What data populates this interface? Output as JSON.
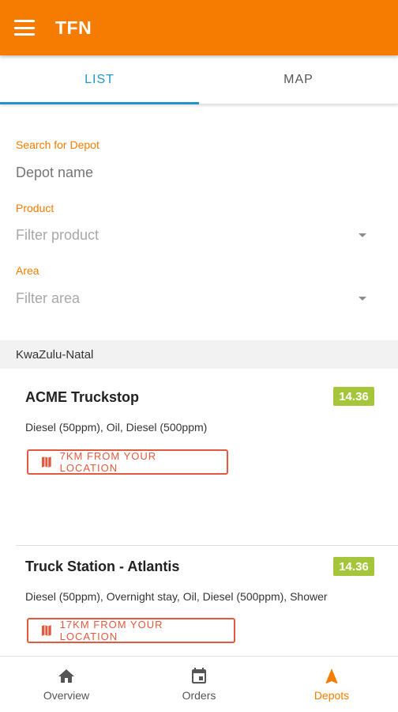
{
  "app": {
    "title": "TFN"
  },
  "tabs": [
    {
      "label": "LIST",
      "active": true
    },
    {
      "label": "MAP",
      "active": false
    }
  ],
  "filters": {
    "search": {
      "label": "Search for Depot",
      "placeholder": "Depot name",
      "value": ""
    },
    "product": {
      "label": "Product",
      "value": "Filter product"
    },
    "area": {
      "label": "Area",
      "value": "Filter area"
    }
  },
  "region": "KwaZulu-Natal",
  "depots": [
    {
      "name": "ACME Truckstop",
      "price": "14.36",
      "products": "Diesel (50ppm), Oil, Diesel (500ppm)",
      "distance": "7KM FROM YOUR LOCATION"
    },
    {
      "name": "Truck Station - Atlantis",
      "price": "14.36",
      "products": "Diesel (50ppm), Overnight stay, Oil, Diesel (500ppm), Shower",
      "distance": "17KM FROM YOUR LOCATION"
    }
  ],
  "bottom_nav": [
    {
      "label": "Overview",
      "icon": "home-icon",
      "active": false
    },
    {
      "label": "Orders",
      "icon": "calendar-icon",
      "active": false
    },
    {
      "label": "Depots",
      "icon": "navigation-arrow-icon",
      "active": true
    }
  ],
  "colors": {
    "primary": "#f57c00",
    "tab_active": "#2196c7",
    "price_badge": "#a5c63b",
    "distance": "#e05a3f"
  }
}
